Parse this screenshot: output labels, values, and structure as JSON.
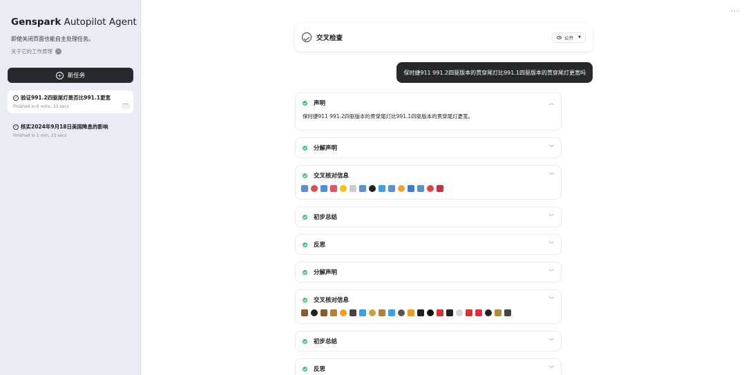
{
  "sidebar": {
    "brand_bold": "Genspark",
    "brand_rest": " Autopilot Agent",
    "subtitle": "即使关闭页面也能自主处理任务。",
    "how_link": "关于它的工作原理",
    "new_task": "新任务",
    "tasks": [
      {
        "title": "验证991.2四驱尾灯是否比991.1更宽",
        "status": "Finished in 6 mins, 23 secs"
      },
      {
        "title": "核实2024年9月18日美国降息的影响",
        "status": "Finished in 1 min, 23 secs"
      }
    ]
  },
  "header": {
    "title": "交叉检查",
    "visibility": "公开"
  },
  "user_message": "保时捷911 991.2四驱版本的贯穿尾灯比991.1四驱版本的贯穿尾灯更宽吗",
  "steps": [
    {
      "label": "声明",
      "expanded": true,
      "body": "保时捷911 991.2四驱版本的贯穿尾灯比991.1四驱版本的贯穿尾灯更宽。"
    },
    {
      "label": "分解声明"
    },
    {
      "label": "交叉核对信息",
      "sources": [
        "#5b8fd6",
        "#e04b4b",
        "#4a8fe0",
        "#e6506a",
        "#f2c400",
        "#c9cdd6",
        "#5b8fd6",
        "#222222",
        "#3aa0e8",
        "#5b8fd6",
        "#f0a030",
        "#3a7bd5",
        "#5b8fd6",
        "#d94545",
        "#c9303a"
      ]
    },
    {
      "label": "初步总结"
    },
    {
      "label": "反思"
    },
    {
      "label": "分解声明"
    },
    {
      "label": "交叉核对信息",
      "sources": [
        "#8a5a2b",
        "#222222",
        "#8a5a2b",
        "#b08040",
        "#f29a1a",
        "#444444",
        "#3aa0e8",
        "#c8a040",
        "#b0803a",
        "#3aa0e8",
        "#555555",
        "#f29a1a",
        "#222222",
        "#111111",
        "#d93030",
        "#222222",
        "#cfd3da",
        "#d93030",
        "#e03040",
        "#222222",
        "#b08a3a",
        "#444444"
      ]
    },
    {
      "label": "初步总结"
    },
    {
      "label": "反思"
    }
  ]
}
